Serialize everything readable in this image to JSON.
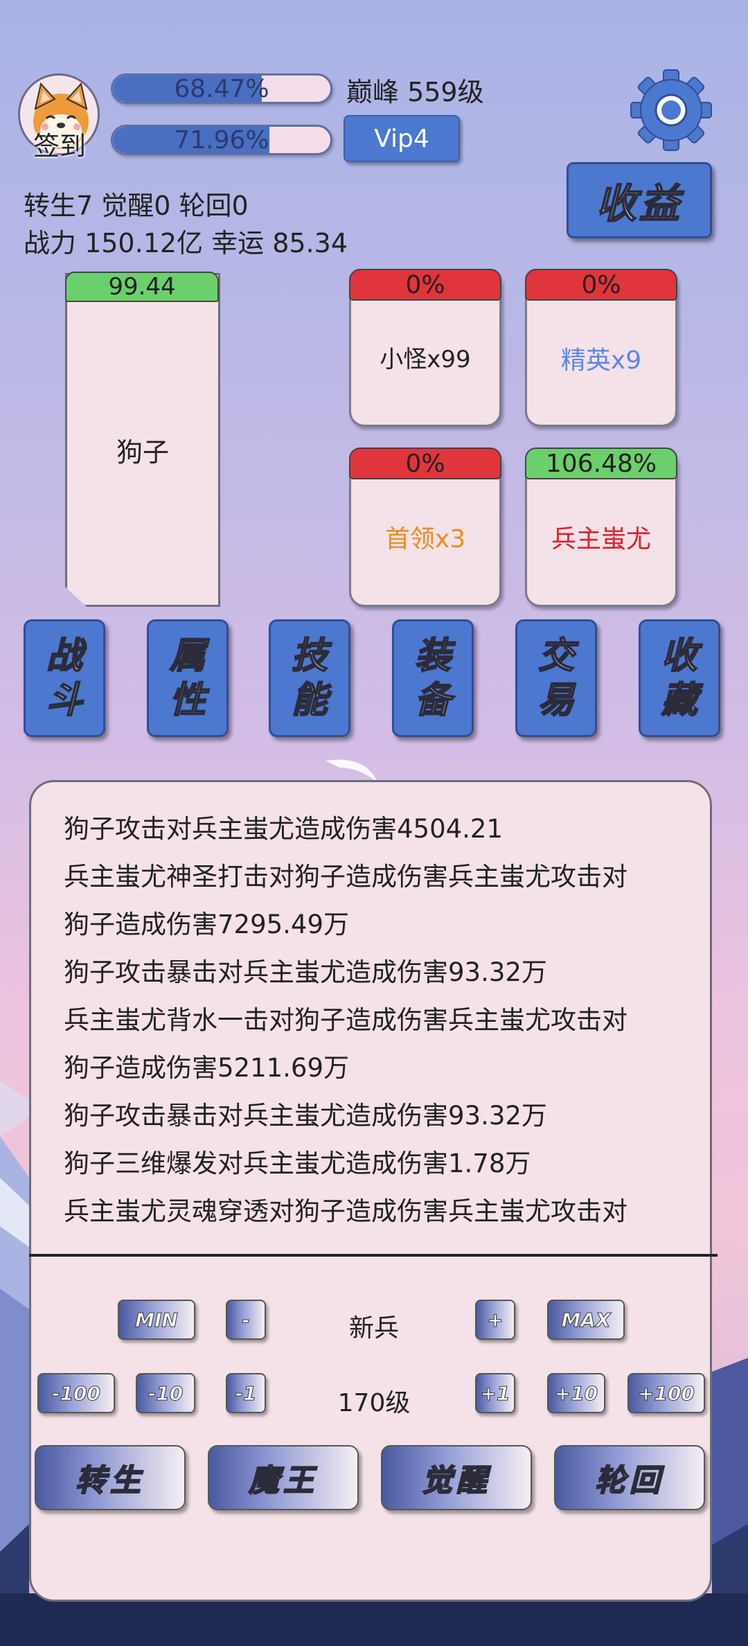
{
  "colors": {
    "accent": "#4c78cf",
    "card_bg": "#f4e2e8",
    "bar_red": "#e0353c",
    "bar_green": "#6bd06b",
    "elite_text": "#5a86e8",
    "boss_text": "#f28a1e",
    "final_boss_text": "#e0202a"
  },
  "header": {
    "avatar_icon": "shiba-dog-avatar",
    "sign_in_label": "签到",
    "exp_bar": {
      "text": "68.47%",
      "fraction": 0.6847
    },
    "second_bar": {
      "text": "71.96%",
      "fraction": 0.7196
    },
    "level_text": "巅峰 559级",
    "vip_label": "Vip4",
    "settings_icon": "gear-icon",
    "income_label": "收益"
  },
  "stats": {
    "line1": "转生7 觉醒0 轮回0",
    "line2": "战力 150.12亿  幸运 85.34"
  },
  "player": {
    "hp_text": "99.44",
    "name": "狗子"
  },
  "enemies": {
    "minion": {
      "hp_text": "0%",
      "label": "小怪x99"
    },
    "elite": {
      "hp_text": "0%",
      "label": "精英x9"
    },
    "leader": {
      "hp_text": "0%",
      "label": "首领x3"
    },
    "boss": {
      "hp_text": "106.48%",
      "label": "兵主蚩尤"
    }
  },
  "menu": {
    "battle": [
      "战",
      "斗"
    ],
    "attributes": [
      "属",
      "性"
    ],
    "skills": [
      "技",
      "能"
    ],
    "equipment": [
      "装",
      "备"
    ],
    "trade": [
      "交",
      "易"
    ],
    "collection": [
      "收",
      "藏"
    ]
  },
  "log": [
    "狗子攻击对兵主蚩尤造成伤害4504.21",
    "兵主蚩尤神圣打击对狗子造成伤害兵主蚩尤攻击对",
    "狗子造成伤害7295.49万",
    "狗子攻击暴击对兵主蚩尤造成伤害93.32万",
    "兵主蚩尤背水一击对狗子造成伤害兵主蚩尤攻击对",
    "狗子造成伤害5211.69万",
    "狗子攻击暴击对兵主蚩尤造成伤害93.32万",
    "狗子三维爆发对兵主蚩尤造成伤害1.78万",
    "兵主蚩尤灵魂穿透对狗子造成伤害兵主蚩尤攻击对"
  ],
  "controls": {
    "row1": {
      "min": "MIN",
      "minus": "-",
      "center": "新兵",
      "plus": "+",
      "max": "MAX"
    },
    "row2": {
      "m100": "-100",
      "m10": "-10",
      "m1": "-1",
      "center": "170级",
      "p1": "+1",
      "p10": "+10",
      "p100": "+100"
    },
    "actions": {
      "rebirth": "转生",
      "demon_king": "魔王",
      "awaken": "觉醒",
      "reincarnation": "轮回"
    }
  }
}
